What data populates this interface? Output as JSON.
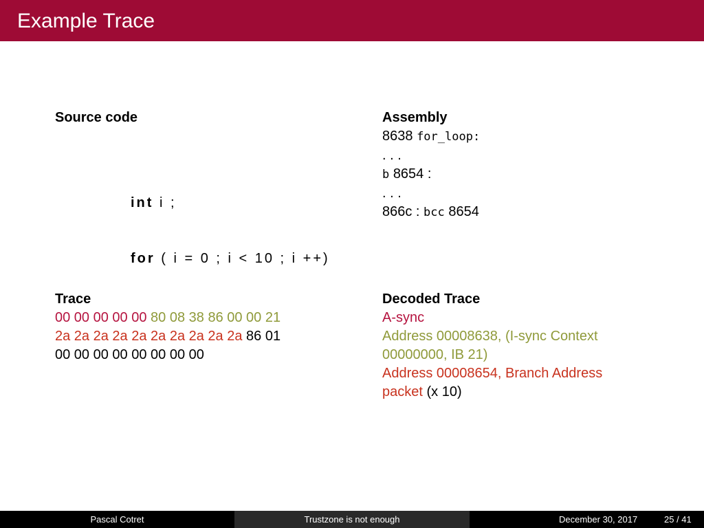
{
  "colors": {
    "title_bar": "#9e0b35",
    "crimson": "#b5133f",
    "olive": "#8f9a3a",
    "red": "#c8321e"
  },
  "title": "Example Trace",
  "source": {
    "heading": "Source code",
    "code": [
      {
        "keyword": "int",
        "rest": "i ;"
      },
      {
        "keyword": "for",
        "rest": "( i  =  0 ;  i  <  10 ;  i ++)"
      }
    ]
  },
  "assembly": {
    "heading": "Assembly",
    "line1_addr": "8638",
    "line1_label": "for_loop:",
    "ellipsis1": ". . .",
    "line3_op": "b",
    "line3_text": "8654 :",
    "ellipsis2": ". . .",
    "line5_addr": "866c :",
    "line5_op": "bcc",
    "line5_target": "8654"
  },
  "trace": {
    "heading": "Trace",
    "async_bytes": "00 00 00 00 00",
    "isync_bytes": "80 08 38 86 00 00 21",
    "branch_bytes": "2a 2a 2a 2a 2a 2a 2a 2a 2a 2a",
    "tail_bytes_1": "86 01",
    "tail_bytes_2": "00 00 00 00 00 00 00 00"
  },
  "decoded": {
    "heading": "Decoded Trace",
    "async": "A-sync",
    "isync_line1": "Address 00008638, (I-sync Context",
    "isync_line2": "00000000, IB 21)",
    "branch_line1": "Address 00008654, Branch Address",
    "branch_line2": "packet",
    "branch_suffix": " (x 10)"
  },
  "footer": {
    "author": "Pascal Cotret",
    "subject": "Trustzone is not enough",
    "date": "December 30, 2017",
    "pages": "25 / 41"
  }
}
